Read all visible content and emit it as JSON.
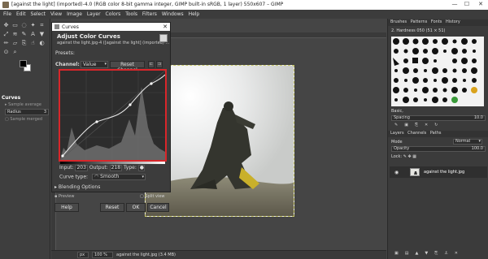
{
  "window": {
    "title": "[against the light] (imported)-4.0 (RGB color 8-bit gamma integer, GIMP built-in sRGB, 1 layer) 550x607 – GIMP",
    "minimize": "—",
    "maximize": "☐",
    "close": "✕"
  },
  "menubar": [
    "File",
    "Edit",
    "Select",
    "View",
    "Image",
    "Layer",
    "Colors",
    "Tools",
    "Filters",
    "Windows",
    "Help"
  ],
  "tool_options": {
    "header": "Curves",
    "sample_average": "Sample average",
    "radius_label": "Radius",
    "radius_value": "3",
    "sample_merged": "Sample merged"
  },
  "dialog": {
    "title": "Curves",
    "heading": "Adjust Color Curves",
    "subtitle": "against the light.jpg-4 ([against the light] (imported) ...",
    "presets_label": "Presets:",
    "channel_label": "Channel:",
    "channel_value": "Value",
    "reset_channel": "Reset Channel",
    "input_label": "Input:",
    "input_value": "203",
    "output_label": "Output:",
    "output_value": "218",
    "type_label": "Type:",
    "curve_type_label": "Curve type:",
    "curve_type_value": "Smooth",
    "blending_options": "Blending Options",
    "preview": "Preview",
    "split_view": "Split view",
    "help": "Help",
    "reset": "Reset",
    "ok": "OK",
    "cancel": "Cancel"
  },
  "statusbar": {
    "unit": "px",
    "zoom": "100 %",
    "file": "against the light.jpg (3.4 MB)"
  },
  "right_panel": {
    "tabs_top": [
      "Brushes",
      "Patterns",
      "Fonts",
      "History"
    ],
    "brush_name": "2. Hardness 050 (51 × 51)",
    "basic_label": "Basic,",
    "spacing_label": "Spacing",
    "spacing_value": "10.0",
    "tabs_bottom": [
      "Layers",
      "Channels",
      "Paths"
    ],
    "mode_label": "Mode",
    "mode_value": "Normal",
    "opacity_label": "Opacity",
    "opacity_value": "100.0",
    "lock_label": "Lock:",
    "layer_name": "against the light.jpg"
  },
  "colors": {
    "highlight": "#d9262a",
    "panel": "#3c3c3c",
    "canvas": "#454545"
  }
}
